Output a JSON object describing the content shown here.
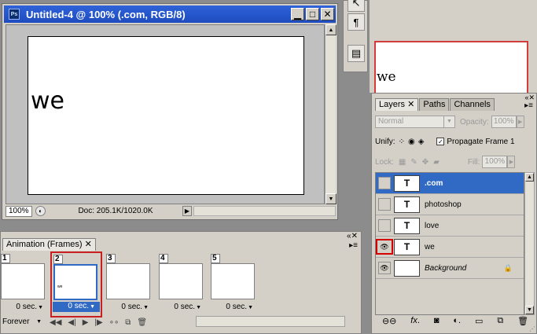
{
  "document": {
    "title": "Untitled-4 @ 100% (.com, RGB/8)",
    "ps_badge": "Ps",
    "canvas_text": "we",
    "zoom": "100%",
    "doc_info": "Doc: 205.1K/1020.0K"
  },
  "nav_preview": {
    "text": "we"
  },
  "layers_panel": {
    "tabs": [
      "Layers",
      "Paths",
      "Channels"
    ],
    "blend_mode": "Normal",
    "opacity_label": "Opacity:",
    "opacity_value": "100%",
    "unify_label": "Unify:",
    "propagate_label": "Propagate Frame 1",
    "lock_label": "Lock:",
    "fill_label": "Fill:",
    "fill_value": "100%",
    "layers": [
      {
        "name": ".com",
        "thumb": "T",
        "visible": false,
        "selected": true
      },
      {
        "name": "photoshop",
        "thumb": "T",
        "visible": false,
        "selected": false
      },
      {
        "name": "love",
        "thumb": "T",
        "visible": false,
        "selected": false
      },
      {
        "name": "we",
        "thumb": "T",
        "visible": true,
        "selected": false
      },
      {
        "name": "Background",
        "thumb": "",
        "visible": true,
        "selected": false,
        "locked": true
      }
    ]
  },
  "animation_panel": {
    "tab": "Animation (Frames)",
    "loop": "Forever",
    "frames": [
      {
        "num": "1",
        "delay": "0 sec."
      },
      {
        "num": "2",
        "delay": "0 sec.",
        "selected": true,
        "thumb_text": "we"
      },
      {
        "num": "3",
        "delay": "0 sec."
      },
      {
        "num": "4",
        "delay": "0 sec."
      },
      {
        "num": "5",
        "delay": "0 sec."
      }
    ]
  }
}
